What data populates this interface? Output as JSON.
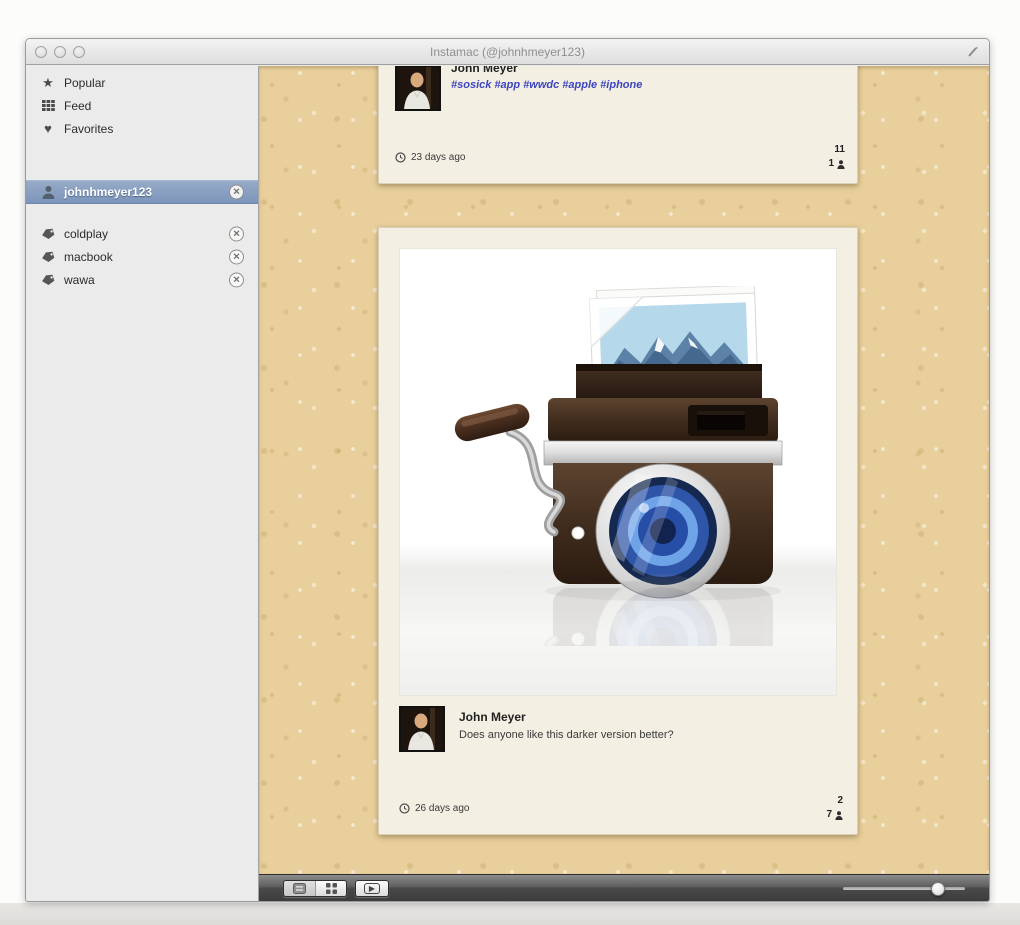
{
  "window": {
    "title": "Instamac (@johnhmeyer123)"
  },
  "sidebar": {
    "nav": [
      {
        "label": "Popular",
        "icon": "star-icon"
      },
      {
        "label": "Feed",
        "icon": "feed-grid-icon"
      },
      {
        "label": "Favorites",
        "icon": "heart-icon"
      }
    ],
    "user": {
      "label": "johnhmeyer123",
      "icon": "person-icon",
      "selected": true
    },
    "tags": [
      {
        "label": "coldplay",
        "icon": "tag-icon"
      },
      {
        "label": "macbook",
        "icon": "tag-icon"
      },
      {
        "label": "wawa",
        "icon": "tag-icon"
      }
    ],
    "remove_glyph": "✕"
  },
  "feed": {
    "posts": [
      {
        "author": "John Meyer",
        "caption": "#sosick #app #wwdc #apple #iphone",
        "time": "23 days ago",
        "likes": "11",
        "comments": "1"
      },
      {
        "author": "John Meyer",
        "caption": "Does anyone like this darker version better?",
        "time": "26 days ago",
        "likes": "2",
        "comments": "7"
      }
    ]
  },
  "toolbar": {
    "view_modes": [
      "list-view",
      "grid-view"
    ],
    "active_view": "list-view",
    "slideshow_glyph": "▶",
    "slider_percent": 78
  },
  "icons": {
    "popular_star": "★",
    "favorites_heart": "♥"
  },
  "colors": {
    "selection_blue": "#7c95ba",
    "cork_tan": "#e8cf9b",
    "hashtag_blue": "#3c45c0",
    "card_cream": "#f3efe2"
  }
}
